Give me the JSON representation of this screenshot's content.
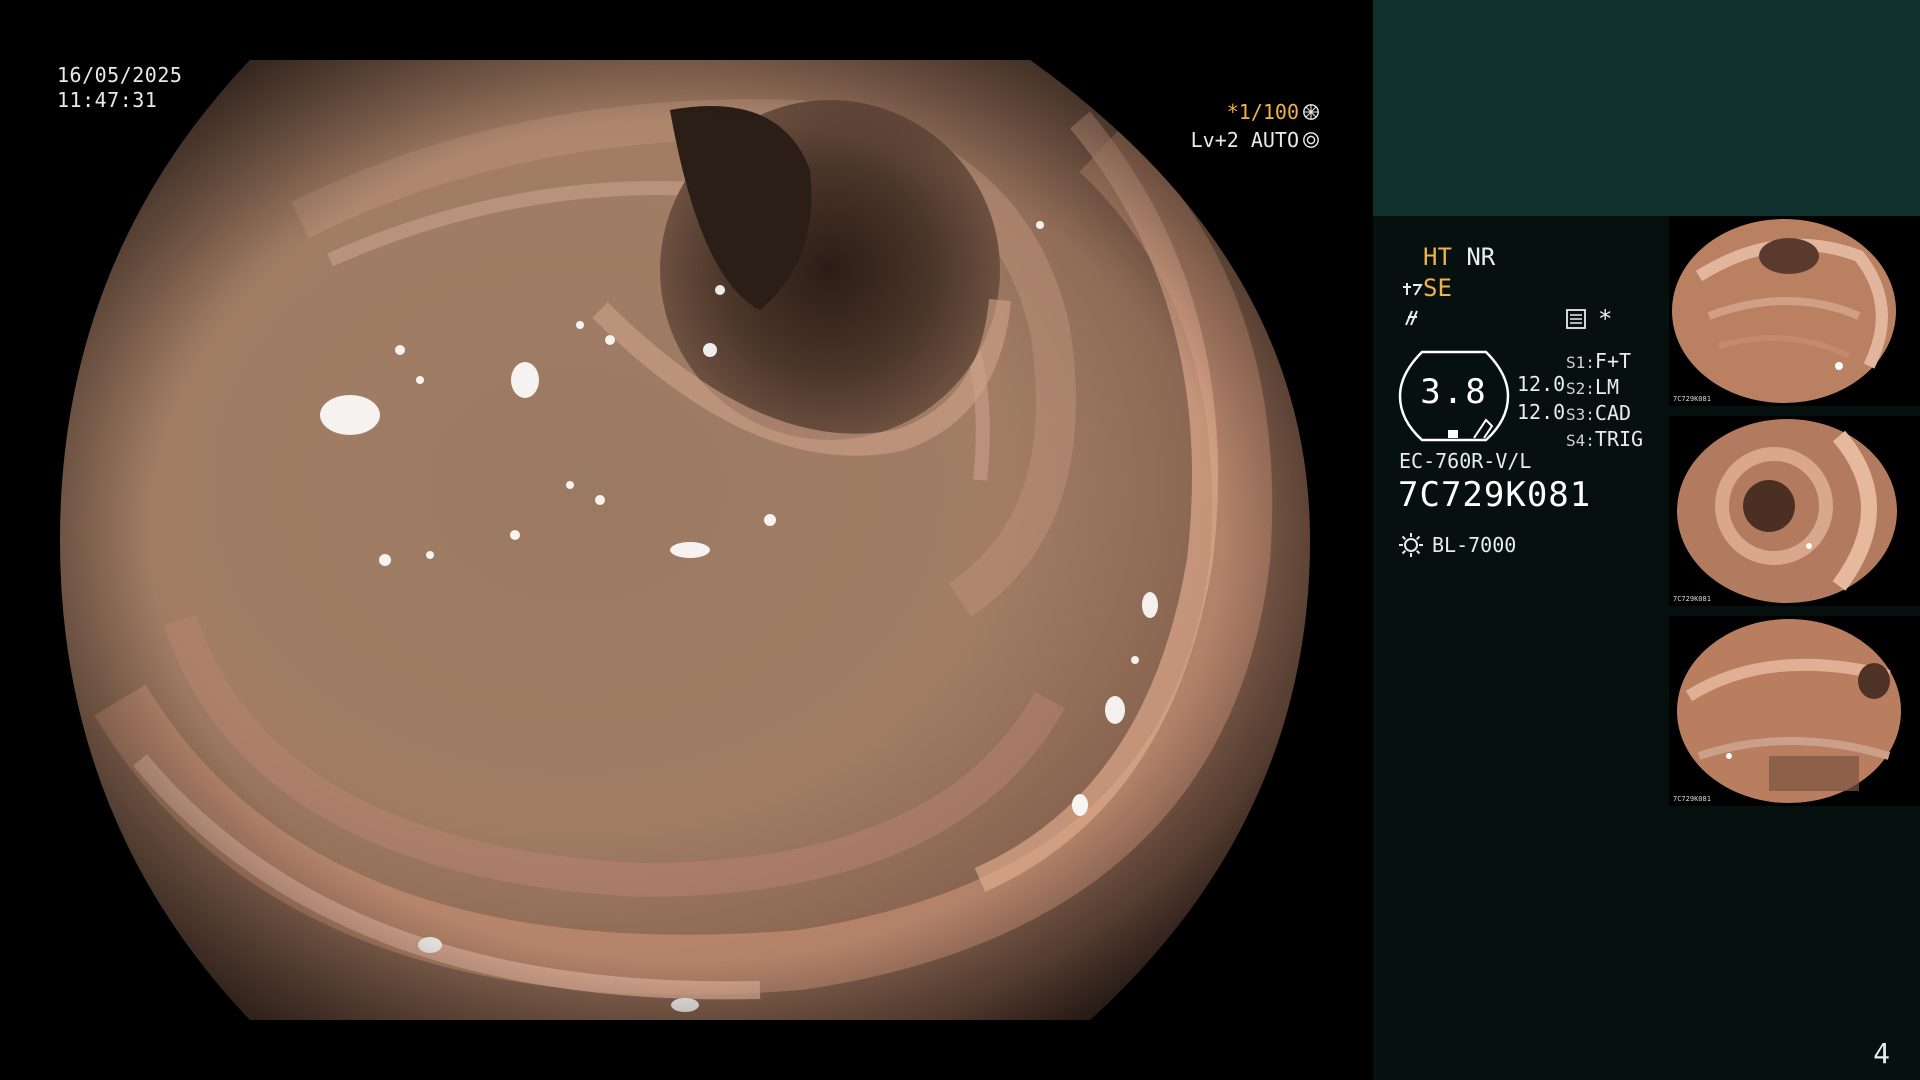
{
  "overlay": {
    "date": "16/05/2025",
    "time": "11:47:31",
    "shutter": "*1/100",
    "gain_level": "Lv+2 AUTO"
  },
  "panel": {
    "ht": "HT",
    "nr": "NR",
    "se": "SE",
    "gauge_value": "3.8",
    "gain_top": "12.0",
    "gain_bottom": "12.0",
    "switches": [
      {
        "key": "S1:",
        "value": "F+T"
      },
      {
        "key": "S2:",
        "value": "LM"
      },
      {
        "key": "S3:",
        "value": "CAD"
      },
      {
        "key": "S4:",
        "value": "TRIG"
      }
    ],
    "scope_model": "EC-760R-V/L",
    "serial": "7C729K081",
    "light_source": "BL-7000",
    "page_number": "4"
  },
  "thumbnails": [
    {
      "name": "thumbnail-1",
      "tag": "7C729K081"
    },
    {
      "name": "thumbnail-2",
      "tag": "7C729K081"
    },
    {
      "name": "thumbnail-3",
      "tag": "7C729K081"
    }
  ],
  "colors": {
    "accent_orange": "#f0b04a",
    "panel_dark": "#06110f",
    "panel_teal": "#0f302d"
  }
}
